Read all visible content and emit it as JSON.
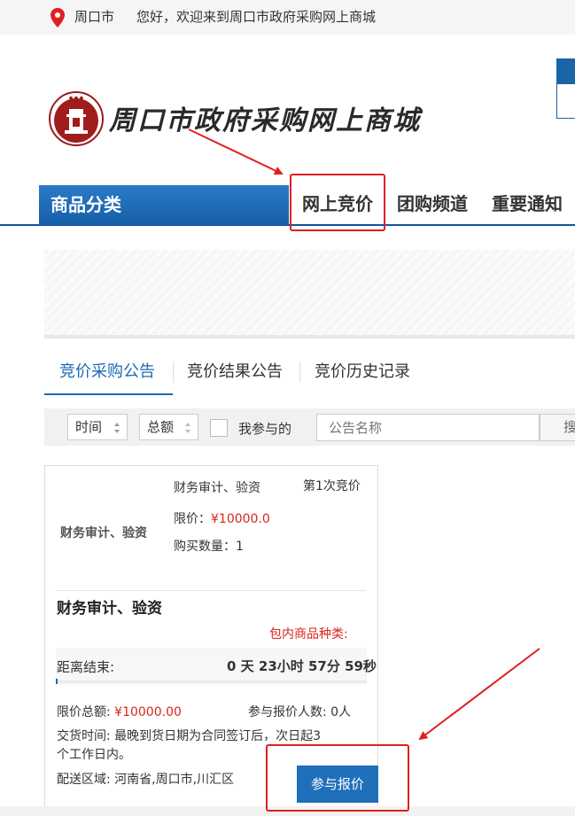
{
  "topbar": {
    "city": "周口市",
    "welcome": "您好，欢迎来到周口市政府采购网上商城"
  },
  "header": {
    "site_name": "周口市政府采购网上商城"
  },
  "nav": {
    "category_label": "商品分类",
    "items": [
      {
        "label": "网上竞价"
      },
      {
        "label": "团购频道"
      },
      {
        "label": "重要通知"
      }
    ]
  },
  "tabs": [
    {
      "label": "竞价采购公告",
      "active": true
    },
    {
      "label": "竞价结果公告",
      "active": false
    },
    {
      "label": "竞价历史记录",
      "active": false
    }
  ],
  "filter": {
    "sort_time": "时间",
    "sort_amount": "总额",
    "my_participation": "我参与的",
    "search_placeholder": "公告名称",
    "search_button": "搜"
  },
  "card": {
    "thumb_label": "财务审计、验资",
    "product_name": "财务审计、验资",
    "round": "第1次竞价",
    "limit_label": "限价：",
    "limit_value": "¥10000.0",
    "quantity": "购买数量：1",
    "title": "财务审计、验资",
    "package_label": "包内商品种类:",
    "countdown_label": "距离结束:",
    "countdown_value": "0 天 23小时 57分 59秒",
    "total_limit_label": "限价总额:",
    "total_limit_value": "¥10000.00",
    "bidders": "参与报价人数: 0人",
    "delivery_time_line1": "交货时间: 最晚到货日期为合同签订后，次日起3",
    "delivery_time_line2": "个工作日内。",
    "delivery_area": "配送区域: 河南省,周口市,川汇区",
    "bid_button": "参与报价",
    "progress_fraction": 0.005
  },
  "colors": {
    "brand_blue": "#1b6ab5",
    "nav_blue": "#1d6ab6",
    "price_red": "#d9251c",
    "annotation_red": "#e02020"
  },
  "icons": [
    "location-pin-icon",
    "emblem-logo-icon",
    "sort-arrows-icon",
    "checkbox-icon"
  ]
}
